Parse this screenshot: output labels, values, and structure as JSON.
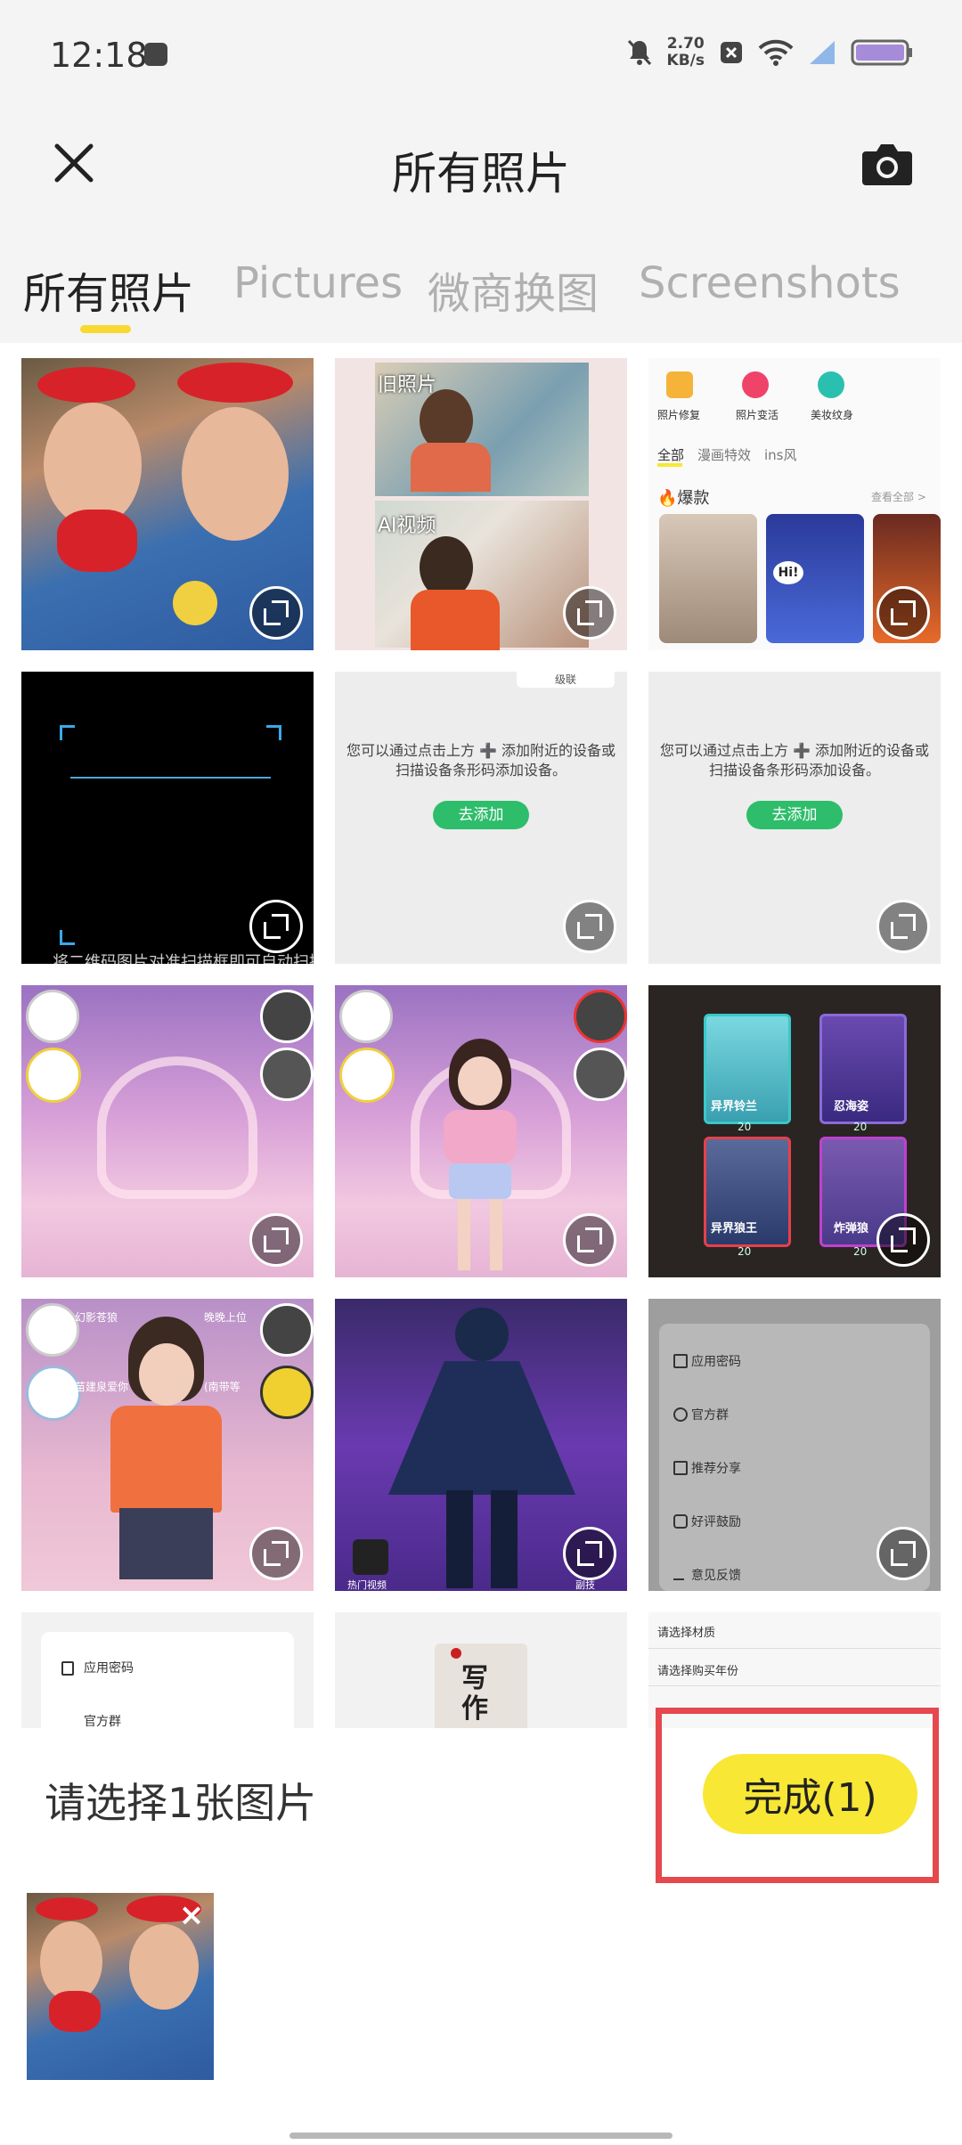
{
  "status": {
    "time": "12:18",
    "net_speed_value": "2.70",
    "net_speed_unit": "KB/s"
  },
  "header": {
    "title": "所有照片",
    "close_icon": "close-icon",
    "camera_icon": "camera-icon"
  },
  "tabs": [
    {
      "label": "所有照片",
      "active": true
    },
    {
      "label": "Pictures",
      "active": false
    },
    {
      "label": "微商换图",
      "active": false
    },
    {
      "label": "Screenshots",
      "active": false
    }
  ],
  "grid": {
    "c2_label_top": "旧照片",
    "c2_label_bottom": "AI视频",
    "c3_actions": [
      "照片修复",
      "照片变活",
      "美妆纹身"
    ],
    "c3_tabs": [
      "全部",
      "漫画特效",
      "ins风"
    ],
    "c3_section": "🔥爆款",
    "c3_more": "查看全部 >",
    "c3_hi": "Hi!",
    "c5_top_label": "级联",
    "device_hint": "您可以通过点击上方 ➕ 添加附近的设备或扫描设备条形码添加设备。",
    "add_button": "去添加",
    "qr_hint": "将二维码图片对准扫描框即可自动扫描",
    "c9_cards": [
      {
        "name": "异界铃兰",
        "price": "20"
      },
      {
        "name": "忍海姿",
        "price": "20"
      },
      {
        "name": "异界狼王",
        "price": "20"
      },
      {
        "name": "炸弹狼",
        "price": "20"
      }
    ],
    "c10_tags": [
      "幻影苍狼",
      "晚晚上位",
      "苗建泉爱你",
      "(南带等"
    ],
    "c11_tags": [
      "热门视频",
      "副技"
    ],
    "settings_menu": [
      "应用密码",
      "官方群",
      "推荐分享",
      "好评鼓励",
      "意见反馈"
    ],
    "r5_left": [
      "应用密码",
      "官方群"
    ],
    "r5_mid": "写作",
    "r5_right": [
      "请选择材质",
      "请选择购买年份"
    ]
  },
  "footer": {
    "hint": "请选择1张图片",
    "done_label": "完成(1)",
    "remove_icon": "close-icon"
  },
  "colors": {
    "accent": "#f8e734",
    "highlight_frame": "#e5484d",
    "green_button": "#2ebd6b"
  }
}
